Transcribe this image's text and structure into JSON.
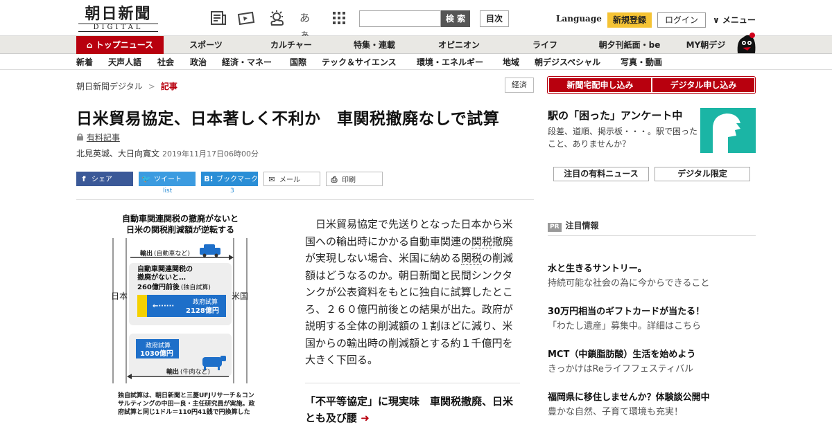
{
  "header": {
    "logo_jp": "朝日新聞",
    "logo_en": "DIGITAL",
    "kana_icon_text": "あぁ",
    "search_label": "検 索",
    "search_placeholder": "",
    "index_label": "目次",
    "language_label": "Language",
    "register_label": "新規登録",
    "login_label": "ログイン",
    "menu_label": "∨ メニュー"
  },
  "main_nav": [
    "トップニュース",
    "スポーツ",
    "カルチャー",
    "特集・連載",
    "オピニオン",
    "ライフ",
    "朝夕刊紙面・be",
    "MY朝デジ"
  ],
  "sub_nav": [
    "新着",
    "天声人語",
    "社会",
    "政治",
    "経済・マネー",
    "国際",
    "テック＆サイエンス",
    "環境・エネルギー",
    "地域",
    "朝デジスペシャル",
    "写真・動画"
  ],
  "breadcrumb": {
    "home": "朝日新聞デジタル",
    "sep": ">",
    "current": "記事"
  },
  "category_tag": "経済",
  "article": {
    "headline": "日米貿易協定、日本著しく不利か　車関税撤廃なしで試算",
    "paid_label": "有料記事",
    "authors": "北見英城、大日向寛文",
    "date": "2019年11月17日06時00分",
    "body_1": "　日米貿易協定で先送りとなった日本から米国への輸出時にかかる自動車関連の",
    "kw_1": "関税",
    "body_2": "撤廃が実現しない場合、米国に納める",
    "kw_2": "関税",
    "body_3": "の削減額はどうなるのか。朝日新聞と民間シンクタンクが公表資料をもとに独自に試算したところ、２６０億円前後との結果が出た。政府が説明する全体の削減額の１割ほどに減り、米国からの輸出時の削減額とする約１千億円を大きく下回る。",
    "related": "「不平等協定」に現実味　車関税撤廃、日米とも及び腰"
  },
  "share": {
    "facebook": "シェア",
    "twitter": "ツイート",
    "twitter_sub": "list",
    "hatena": "ブックマーク",
    "hatena_count": "3",
    "mail": "メール",
    "print": "印刷"
  },
  "graphic": {
    "title_1": "自動車関連関税の撤廃がないと",
    "title_2": "日米の関税削減額が逆転する",
    "left_label": "日本",
    "right_label": "米国",
    "export_car": "輸出",
    "export_car_note": "(自動車など)",
    "scenario_1": "自動車関連関税の",
    "scenario_2": "撤廃がないと…",
    "amount_est": "260億円前後",
    "amount_est_note": "(独自試算)",
    "gov_est_label": "政府試算",
    "gov_est_jp": "2128億円",
    "gov_est_us": "1030億円",
    "export_beef": "輸出",
    "export_beef_note": "(牛肉など)",
    "caption": "独自試算は、朝日新聞と三菱UFJリサーチ＆コンサルティングの中田一良・主任研究員が実施。政府試算と同じ1ドル＝110円41銭で円換算した"
  },
  "sidebar": {
    "btn_delivery": "新聞宅配申し込み",
    "btn_digital": "デジタル申し込み",
    "survey_title": "駅の「困った」アンケート中",
    "survey_desc": "段差、道順、掲示板・・・。駅で困ったこと、ありませんか？",
    "tab_paid_news": "注目の有料ニュース",
    "tab_digital_only": "デジタル限定",
    "pr_badge": "PR",
    "pr_heading": "注目情報",
    "ads": [
      {
        "title": "水と生きるサントリー。",
        "desc": "持続可能な社会の為に今からできること"
      },
      {
        "title": "30万円相当のギフトカードが当たる！",
        "desc": "「わたし遺産」募集中。詳細はこちら"
      },
      {
        "title": "MCT（中鎖脂肪酸）生活を始めよう",
        "desc": "きっかけはReライフフェスティバル"
      },
      {
        "title": "福岡県に移住しませんか？体験談公開中",
        "desc": "豊かな自然、子育て環境も充実！"
      }
    ]
  },
  "colors": {
    "brand_red": "#b8000e",
    "register_yellow": "#f5c334",
    "survey_teal": "#1bb5a5",
    "gov_blue": "#1e6fc9"
  }
}
